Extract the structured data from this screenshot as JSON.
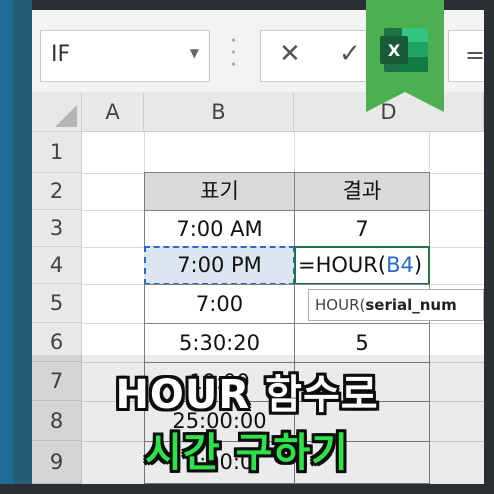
{
  "formula_bar": {
    "name_box": "IF",
    "cancel_icon": "close-icon",
    "enter_icon": "check-icon",
    "formula_prefix": "="
  },
  "columns": [
    "A",
    "B",
    "D"
  ],
  "rows": [
    "1",
    "2",
    "3",
    "4",
    "5",
    "6",
    "7",
    "8",
    "9"
  ],
  "table": {
    "headers": [
      "표기",
      "결과"
    ],
    "rows": [
      {
        "b": "7:00 AM",
        "d": "7"
      },
      {
        "b": "7:00 PM",
        "d_formula_prefix": "=HOUR(",
        "d_ref": "B4",
        "d_formula_suffix": ")"
      },
      {
        "b": "7:00",
        "d": ""
      },
      {
        "b": "5:30:20",
        "d": "5"
      },
      {
        "b": "19:00",
        "d": ""
      },
      {
        "b": "25:00:00",
        "d": ""
      },
      {
        "b": "9:00:0",
        "d": ""
      }
    ]
  },
  "tooltip": {
    "func": "HOUR(",
    "arg": "serial_num"
  },
  "banner": {
    "line1": "HOUR 함수로",
    "line2": "시간 구하기"
  },
  "excel_logo": {
    "letter": "X",
    "accent_green": "#4caf50",
    "dark_green": "#217346"
  }
}
